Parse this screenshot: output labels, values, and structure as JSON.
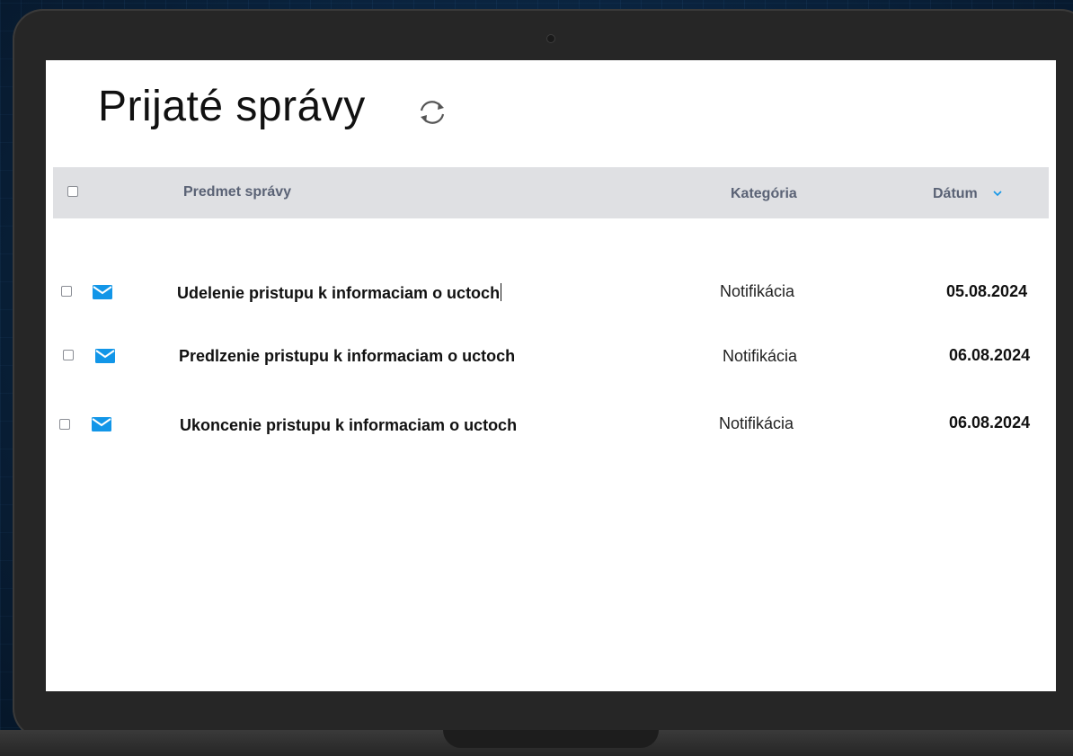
{
  "page": {
    "title": "Prijaté správy"
  },
  "icons": {
    "refresh": "refresh-icon",
    "mail": "envelope-icon",
    "sort": "chevron-down-icon"
  },
  "colors": {
    "accent": "#1296e8",
    "header_bg": "#dfe0e3",
    "header_text": "#5a6275"
  },
  "table": {
    "columns": {
      "subject": "Predmet správy",
      "category": "Kategória",
      "date": "Dátum"
    },
    "rows": [
      {
        "subject": "Udelenie pristupu k informaciam o uctoch",
        "category": "Notifikácia",
        "date": "05.08.2024"
      },
      {
        "subject": "Predlzenie pristupu k informaciam o uctoch",
        "category": "Notifikácia",
        "date": "06.08.2024"
      },
      {
        "subject": "Ukoncenie pristupu k informaciam o uctoch",
        "category": "Notifikácia",
        "date": "06.08.2024"
      }
    ]
  }
}
